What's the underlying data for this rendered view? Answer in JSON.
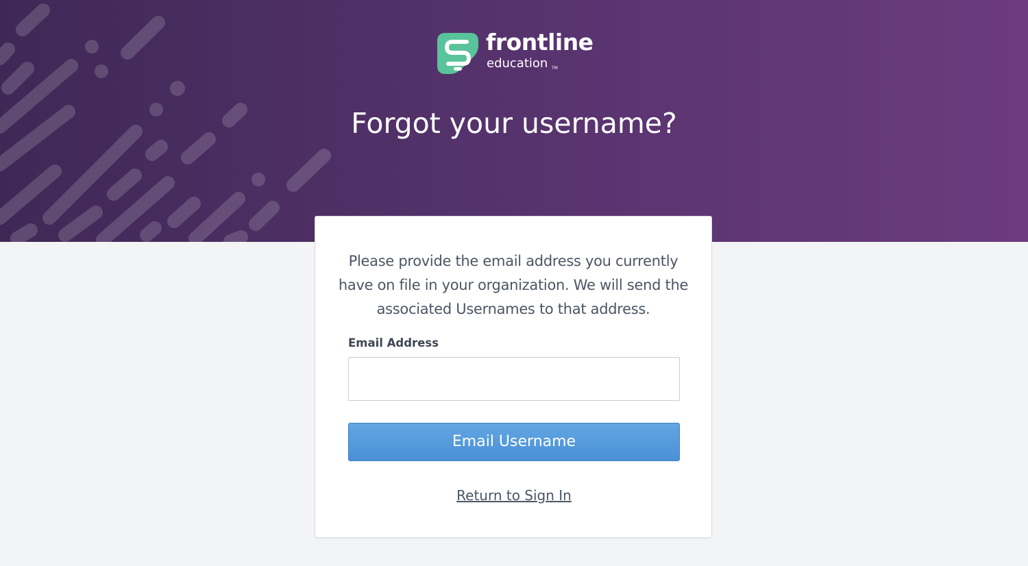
{
  "brand": {
    "name": "frontline",
    "sub": "education",
    "trademark": "TM",
    "icon": "frontline-logo-icon",
    "colors": {
      "logo_green": "#59c39b",
      "hero_left": "#3f2856",
      "hero_right": "#6c3b7f",
      "button_blue": "#4a90d6"
    }
  },
  "header": {
    "title": "Forgot your username?"
  },
  "form": {
    "instructions": "Please provide the email address you currently have on file in your organization. We will send the associated Usernames to that address.",
    "email_label": "Email Address",
    "email_value": "",
    "submit_label": "Email Username",
    "return_link": "Return to Sign In"
  }
}
